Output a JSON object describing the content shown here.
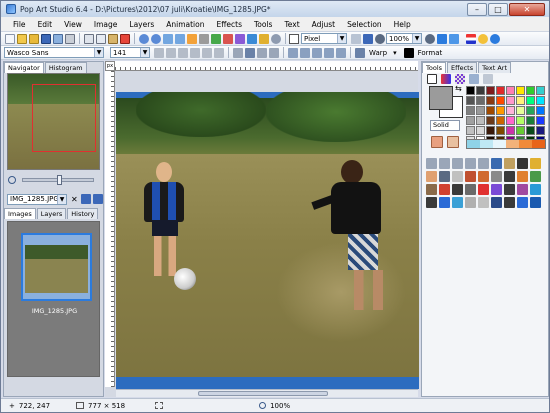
{
  "window": {
    "title": "Pop Art Studio 6.4 - D:\\Pictures\\2012\\07 juli\\Kroatie\\IMG_1285.JPG*",
    "min": "–",
    "max": "□",
    "close": "✕"
  },
  "menu": [
    "File",
    "Edit",
    "View",
    "Image",
    "Layers",
    "Animation",
    "Effects",
    "Tools",
    "Text",
    "Adjust",
    "Selection",
    "Help"
  ],
  "toolbar2": {
    "font": "Wasco Sans",
    "size": "141",
    "warp": "Warp",
    "format": "Format"
  },
  "toolbar1": {
    "pixel": "Pixel",
    "zoom": "100%"
  },
  "left_panel": {
    "top_tabs": [
      "Navigator",
      "Histogram"
    ],
    "image_select": "IMG_1285.JPG",
    "bottom_tabs": [
      "Images",
      "Layers",
      "History"
    ],
    "thumb_caption": "IMG_1285.JPG"
  },
  "ruler": {
    "corner": "px",
    "h_ticks": [
      "0",
      "50",
      "100",
      "150",
      "200",
      "250",
      "300",
      "350",
      "400",
      "450",
      "500",
      "550",
      "600",
      "650",
      "700",
      "750"
    ]
  },
  "right_panel": {
    "tabs": [
      "Tools",
      "Effects",
      "Text Art"
    ],
    "fill_mode": "Solid",
    "palette": [
      "#000000",
      "#3a3a3a",
      "#7f1b1b",
      "#e02a2a",
      "#ff7fb1",
      "#ffe600",
      "#2fcf2f",
      "#33cfcf",
      "#555555",
      "#6b6b6b",
      "#8a3a12",
      "#ff4a00",
      "#ff99cc",
      "#fff27a",
      "#00ff7f",
      "#00e5ff",
      "#808080",
      "#9a9a9a",
      "#a04a00",
      "#ff9900",
      "#ffb3d9",
      "#e6ff99",
      "#26a65b",
      "#0077ff",
      "#a0a0a0",
      "#bdbdbd",
      "#6b3a1a",
      "#cc6600",
      "#ff66cc",
      "#b3ff66",
      "#1a7f3a",
      "#1a3aff",
      "#c0c0c0",
      "#d8d8d8",
      "#3a1a0a",
      "#7f4a00",
      "#cc33aa",
      "#66cc33",
      "#0a4a1a",
      "#1a1a7f",
      "#e0e0e0",
      "#ffffff",
      "#1a0a00",
      "#4a2a00",
      "#7f007f",
      "#338033",
      "#003300",
      "#00007f"
    ],
    "gradient": [
      "#8fd3e8",
      "#bfe8f4",
      "#e8f6fb",
      "#f2b27a",
      "#f08a3a",
      "#e8641a"
    ]
  },
  "status": {
    "coords": "722, 247",
    "size": "777 × 518",
    "zoom": "100%"
  },
  "colors": {
    "accent": "#2b7bde",
    "sky": "#2c6cbf",
    "grass": "#8a7a4a"
  }
}
